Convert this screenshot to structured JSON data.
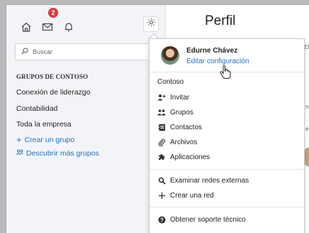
{
  "header": {
    "badge_count": "2",
    "title": "Perfil"
  },
  "search": {
    "placeholder": "Buscar"
  },
  "sidebar": {
    "groups_heading": "GRUPOS DE CONTOSO",
    "items": [
      {
        "label": "Conexión de liderazgo"
      },
      {
        "label": "Contabilidad"
      },
      {
        "label": "Toda la empresa"
      }
    ],
    "create_group": "Crear un grupo",
    "discover_groups": "Descubrir más grupos"
  },
  "profile_menu": {
    "name": "Edurne Chávez",
    "edit_link": "Editar configuración",
    "network_label": "Contoso",
    "items": [
      {
        "label": "Invitar",
        "icon": "add-person-icon"
      },
      {
        "label": "Grupos",
        "icon": "people-icon"
      },
      {
        "label": "Contactos",
        "icon": "contacts-icon"
      },
      {
        "label": "Archivos",
        "icon": "paperclip-icon"
      },
      {
        "label": "Aplicaciones",
        "icon": "puzzle-icon"
      }
    ],
    "network_items": [
      {
        "label": "Examinar redes externas",
        "icon": "search-icon"
      },
      {
        "label": "Crear una red",
        "icon": "plus-icon"
      }
    ],
    "support": {
      "label": "Obtener soporte técnico",
      "icon": "help-icon"
    }
  },
  "colors": {
    "link": "#1b73c9",
    "badge": "#e0383e",
    "sidebar_bg": "#f3f4f7"
  }
}
